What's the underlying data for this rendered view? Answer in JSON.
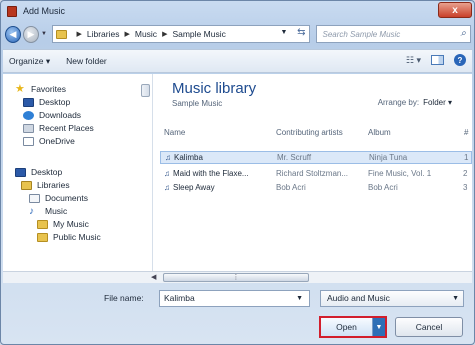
{
  "window": {
    "title": "Add Music",
    "close_label": "x"
  },
  "address": {
    "crumbs": [
      "Libraries",
      "Music",
      "Sample Music"
    ],
    "search_placeholder": "Search Sample Music"
  },
  "toolbar": {
    "organize": "Organize ▾",
    "new_folder": "New folder"
  },
  "nav": {
    "favorites": "Favorites",
    "desktop_fav": "Desktop",
    "downloads": "Downloads",
    "recent_places": "Recent Places",
    "onedrive": "OneDrive",
    "desktop": "Desktop",
    "libraries": "Libraries",
    "documents": "Documents",
    "music": "Music",
    "my_music": "My Music",
    "public_music": "Public Music"
  },
  "library": {
    "title": "Music library",
    "subtitle": "Sample Music",
    "arrange_label": "Arrange by:",
    "arrange_value": "Folder ▾"
  },
  "columns": [
    "Name",
    "Contributing artists",
    "Album",
    "#"
  ],
  "files": [
    {
      "name": "Kalimba",
      "artist": "Mr. Scruff",
      "album": "Ninja Tuna",
      "num": "1"
    },
    {
      "name": "Maid with the Flaxe...",
      "artist": "Richard Stoltzman...",
      "album": "Fine Music, Vol. 1",
      "num": "2"
    },
    {
      "name": "Sleep Away",
      "artist": "Bob Acri",
      "album": "Bob Acri",
      "num": "3"
    }
  ],
  "footer": {
    "file_name_label": "File name:",
    "file_name_value": "Kalimba",
    "filter_value": "Audio and Music",
    "open_label": "Open",
    "cancel_label": "Cancel"
  },
  "colors": {
    "highlight": "#d21e2c",
    "accent": "#1e4b8f"
  }
}
